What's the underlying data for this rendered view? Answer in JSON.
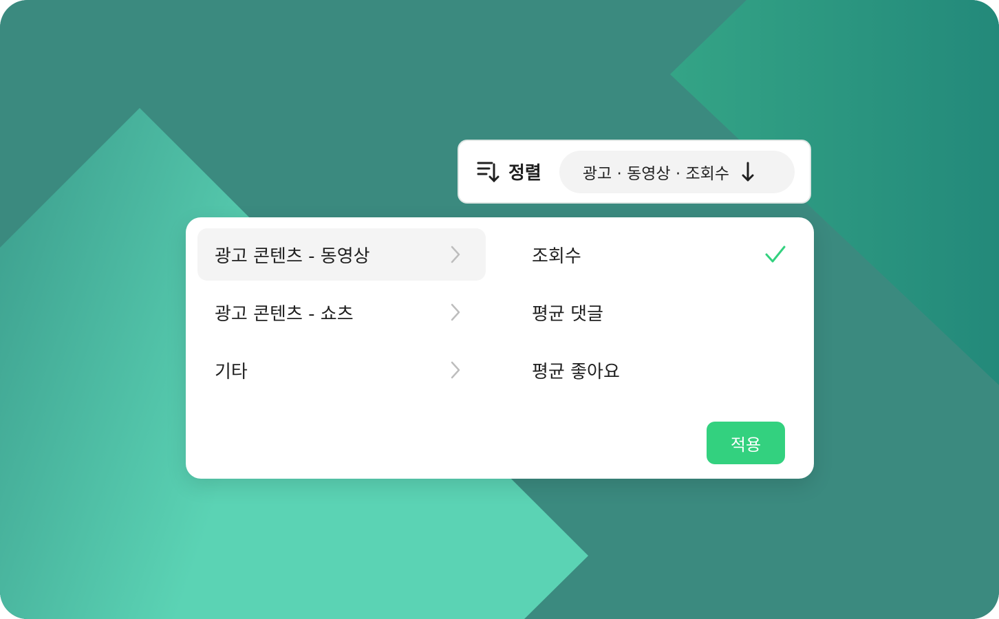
{
  "sort_bar": {
    "icon": "sort-descending-icon",
    "label": "정렬",
    "selection_text": "광고 · 동영상 · 조회수",
    "direction_icon": "arrow-down-icon"
  },
  "panel": {
    "categories": [
      {
        "label": "광고 콘텐츠 - 동영상",
        "active": true,
        "icon": "chevron-right-icon"
      },
      {
        "label": "광고 콘텐츠 - 쇼츠",
        "active": false,
        "icon": "chevron-right-icon"
      },
      {
        "label": "기타",
        "active": false,
        "icon": "chevron-right-icon"
      }
    ],
    "metrics": [
      {
        "label": "조회수",
        "selected": true,
        "icon": "check-icon"
      },
      {
        "label": "평균 댓글",
        "selected": false
      },
      {
        "label": "평균 좋아요",
        "selected": false
      }
    ],
    "apply_label": "적용"
  },
  "colors": {
    "background": "#3b8a7f",
    "accent_light": "#5bd3b2",
    "apply_button": "#33d17f",
    "check": "#33d17f",
    "active_row": "#f4f4f4"
  }
}
